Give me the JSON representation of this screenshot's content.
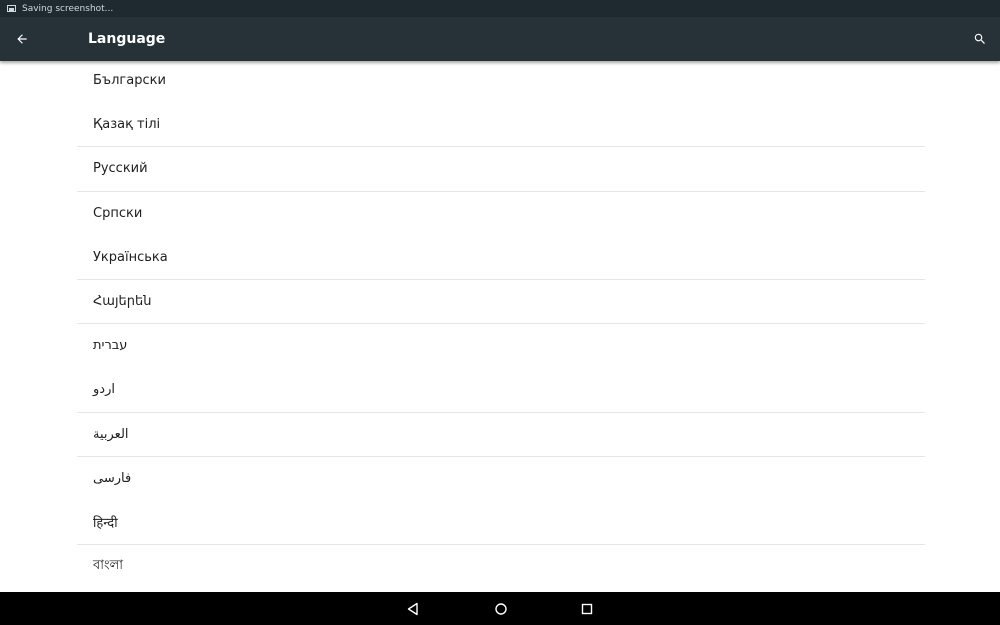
{
  "status_bar": {
    "notification_icon": "image-icon",
    "text": "Saving screenshot..."
  },
  "app_bar": {
    "back_icon": "arrow-back-icon",
    "title": "Language",
    "search_icon": "search-icon"
  },
  "languages": [
    "Български",
    "Қазақ тілі",
    "Русский",
    "Српски",
    "Українська",
    "Հայերեն",
    "עברית",
    "اردو",
    "العربية",
    "فارسی",
    "हिन्दी",
    "বাংলা"
  ],
  "nav_bar": {
    "back_icon": "nav-back-icon",
    "home_icon": "nav-home-icon",
    "recents_icon": "nav-recents-icon"
  }
}
